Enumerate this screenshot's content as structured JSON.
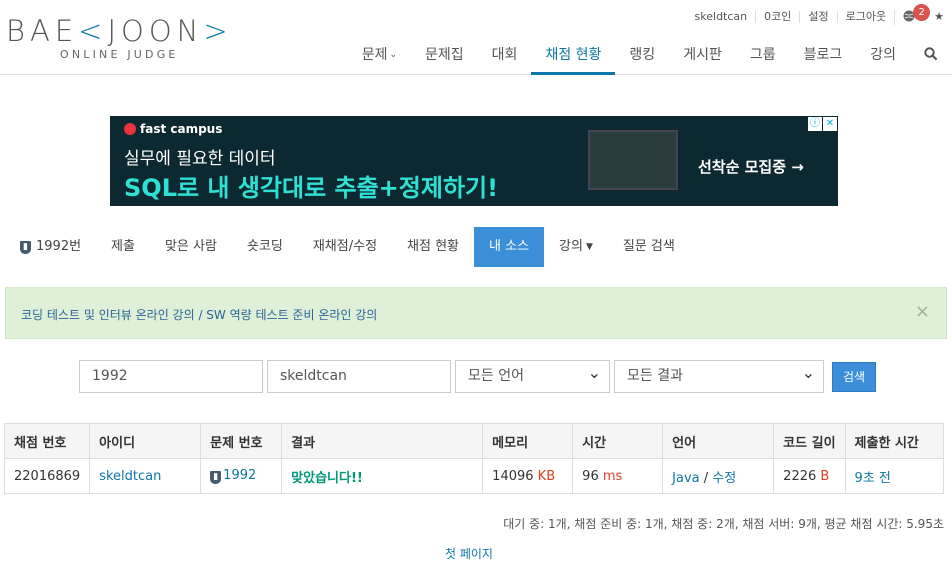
{
  "logo": {
    "part1": "BAE",
    "accent1": "<",
    "part2": "JOON",
    "accent2": ">",
    "subtitle": "ONLINE JUDGE"
  },
  "topbar": {
    "user": "skeldtcan",
    "coins": "0코인",
    "settings": "설정",
    "logout": "로그아웃",
    "notifications": "2",
    "star": "★"
  },
  "nav": [
    {
      "label": "문제",
      "has_dropdown": true
    },
    {
      "label": "문제집"
    },
    {
      "label": "대회"
    },
    {
      "label": "채점 현황",
      "active": true
    },
    {
      "label": "랭킹"
    },
    {
      "label": "게시판"
    },
    {
      "label": "그룹"
    },
    {
      "label": "블로그"
    },
    {
      "label": "강의"
    }
  ],
  "ad": {
    "brand": "fast campus",
    "line1": "실무에 필요한 데이터",
    "line2": "SQL로 내 생각대로 추출+정제하기!",
    "cta": "선착순 모집중 →"
  },
  "problem_menu": {
    "problem_id": "1992번",
    "items": [
      "제출",
      "맞은 사람",
      "숏코딩",
      "재채점/수정",
      "채점 현황",
      "내 소스",
      "강의",
      "질문 검색"
    ],
    "active_index": 5
  },
  "alert": {
    "text": "코딩 테스트 및 인터뷰 온라인 강의 / SW 역량 테스트 준비 온라인 강의",
    "close": "×"
  },
  "filter": {
    "problem_id": "1992",
    "user_id": "skeldtcan",
    "language": "모든 언어",
    "result": "모든 결과",
    "search_button": "검색"
  },
  "table": {
    "headers": [
      "채점 번호",
      "아이디",
      "문제 번호",
      "결과",
      "메모리",
      "시간",
      "언어",
      "코드 길이",
      "제출한 시간"
    ],
    "rows": [
      {
        "submission_id": "22016869",
        "user": "skeldtcan",
        "problem": "1992",
        "result": "맞았습니다!!",
        "memory": "14096",
        "memory_unit": "KB",
        "time": "96",
        "time_unit": "ms",
        "language": "Java",
        "edit": "수정",
        "code_length": "2226",
        "code_unit": "B",
        "submitted": "9초 전"
      }
    ]
  },
  "queue_info": "대기 중: 1개, 채점 준비 중: 1개, 채점 중: 2개, 채점 서버: 9개, 평균 채점 시간: 5.95초",
  "pagination": {
    "first_page": "첫 페이지"
  },
  "colors": {
    "accent": "#0e76a8",
    "active_tab": "#3b8fd9",
    "accepted": "#009874",
    "unit": "#dd4124"
  }
}
